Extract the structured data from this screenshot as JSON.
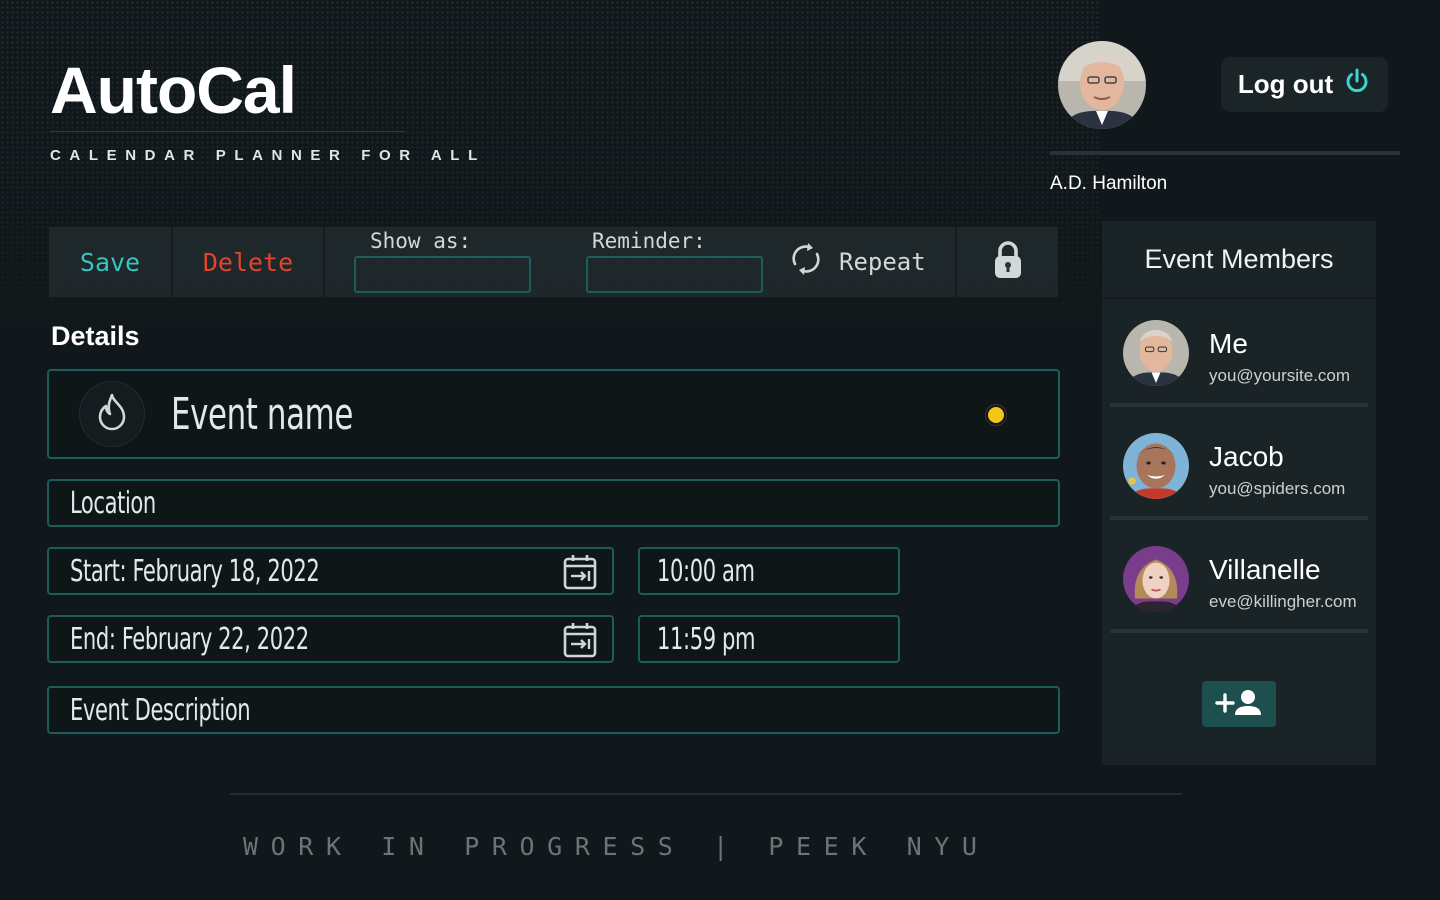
{
  "brand": {
    "title": "AutoCal",
    "subtitle": "CALENDAR PLANNER FOR ALL"
  },
  "user": {
    "name": "A.D. Hamilton",
    "logout_label": "Log out",
    "logout_icon": "power-icon"
  },
  "toolbar": {
    "save_label": "Save",
    "delete_label": "Delete",
    "show_as_label": "Show as:",
    "show_as_value": "",
    "reminder_label": "Reminder:",
    "reminder_value": "",
    "repeat_label": "Repeat",
    "lock_icon": "lock-icon"
  },
  "details": {
    "section_title": "Details",
    "event_name_placeholder": "Event name",
    "event_icon": "flame-icon",
    "event_color": "#f5c518",
    "location_placeholder": "Location",
    "start_date": "Start: February 18, 2022",
    "start_time": "10:00 am",
    "end_date": "End: February 22, 2022",
    "end_time": "11:59 pm",
    "description_placeholder": "Event Description"
  },
  "members": {
    "title": "Event Members",
    "items": [
      {
        "name": "Me",
        "email": "you@yoursite.com"
      },
      {
        "name": "Jacob",
        "email": "you@spiders.com"
      },
      {
        "name": "Villanelle",
        "email": "eve@killingher.com"
      }
    ],
    "add_icon": "add-user-icon"
  },
  "footer": {
    "text": "WORK IN PROGRESS | PEEK NYU"
  },
  "colors": {
    "accent": "#38c4c0",
    "danger": "#e4432e",
    "border": "#1c5d5a",
    "background": "#11181b"
  }
}
